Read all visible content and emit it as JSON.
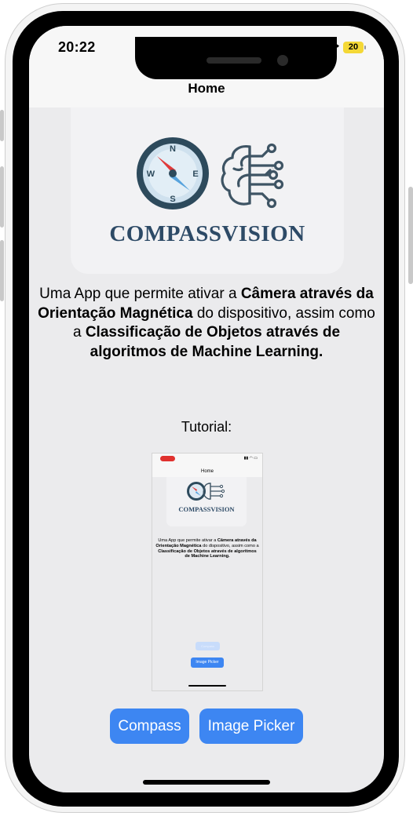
{
  "status_bar": {
    "time": "20:22",
    "battery": "20"
  },
  "nav": {
    "title": "Home"
  },
  "logo": {
    "text": "COMPASSVISION",
    "compass_letters": {
      "n": "N",
      "e": "E",
      "s": "S",
      "w": "W"
    }
  },
  "description": {
    "part1": "Uma App que permite ativar a ",
    "bold1": "Câmera através da Orientação Magnética",
    "part2": " do dispositivo, assim como a ",
    "bold2": "Classificação de Objetos através de algoritmos de Machine Learning."
  },
  "tutorial": {
    "label": "Tutorial:",
    "mini": {
      "title": "Home",
      "logo_text": "COMPASSVISION",
      "button_compass": "Compass",
      "button_image_picker": "Image Picker"
    }
  },
  "buttons": {
    "compass": "Compass",
    "image_picker": "Image Picker"
  },
  "colors": {
    "accent": "#3d86f2",
    "logo_text": "#2d4a66",
    "battery": "#f4d836",
    "background": "#ebebed"
  }
}
